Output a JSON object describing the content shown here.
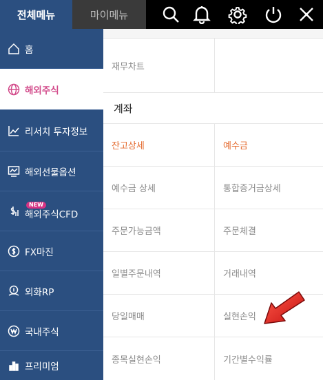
{
  "header": {
    "tab_all": "전체메뉴",
    "tab_my": "마이메뉴",
    "icons": [
      "search-icon",
      "bell-icon",
      "gear-icon",
      "power-icon",
      "close-icon"
    ]
  },
  "sidebar": {
    "items": [
      {
        "label": "홈",
        "icon": "home-icon"
      },
      {
        "label": "해외주식",
        "icon": "globe-icon",
        "active": true
      },
      {
        "label": "리서치 투자정보",
        "icon": "chart-line-icon"
      },
      {
        "label": "해외선물옵션",
        "icon": "monitor-chart-icon"
      },
      {
        "label": "해외주식CFD",
        "badge": "NEW",
        "icon": "dollar-bars-icon"
      },
      {
        "label": "FX마진",
        "icon": "dollar-circle-icon"
      },
      {
        "label": "외화RP",
        "icon": "coin-hand-icon"
      },
      {
        "label": "국내주식",
        "icon": "won-circle-icon"
      },
      {
        "label": "프리미엄",
        "icon": "bar-chart-icon"
      }
    ]
  },
  "content": {
    "top_row": {
      "left": "재무차트",
      "right": ""
    },
    "section_title": "계좌",
    "rows": [
      {
        "left": "잔고상세",
        "right": "예수금"
      },
      {
        "left": "예수금 상세",
        "right": "통합증거금상세"
      },
      {
        "left": "주문가능금액",
        "right": "주문체결"
      },
      {
        "left": "일별주문내역",
        "right": "거래내역"
      },
      {
        "left": "당일매매",
        "right": "실현손익"
      },
      {
        "left": "종목실현손익",
        "right": "기간별수익률"
      }
    ]
  },
  "colors": {
    "sidebar_bg": "#2b4f80",
    "active_text": "#d24a8a",
    "highlight_text": "#e46a2e",
    "arrow_red": "#e8231f"
  }
}
